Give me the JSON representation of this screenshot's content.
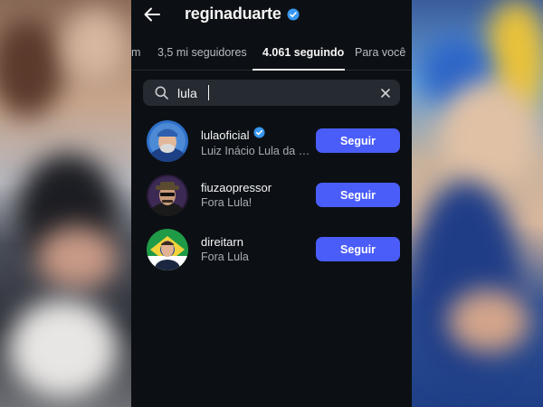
{
  "header": {
    "username": "reginaduarte",
    "back_icon": "arrow-left-icon",
    "verified_icon": "verified-badge-icon"
  },
  "tabs": [
    {
      "label": "m",
      "active": false
    },
    {
      "label": "3,5 mi seguidores",
      "active": false
    },
    {
      "label": "4.061 seguindo",
      "active": true
    },
    {
      "label": "Para você",
      "active": false
    }
  ],
  "search": {
    "value": "lula",
    "search_icon": "search-icon",
    "clear_icon": "close-icon"
  },
  "results": [
    {
      "handle": "lulaoficial",
      "verified": true,
      "subtitle": "Luiz Inácio Lula da S...",
      "button": "Seguir"
    },
    {
      "handle": "fiuzaopressor",
      "verified": false,
      "subtitle": "Fora Lula!",
      "button": "Seguir"
    },
    {
      "handle": "direitarn",
      "verified": false,
      "subtitle": "Fora Lula",
      "button": "Seguir"
    }
  ],
  "colors": {
    "background": "#0c1014",
    "button": "#4a5df9",
    "verified": "#3897f0"
  }
}
